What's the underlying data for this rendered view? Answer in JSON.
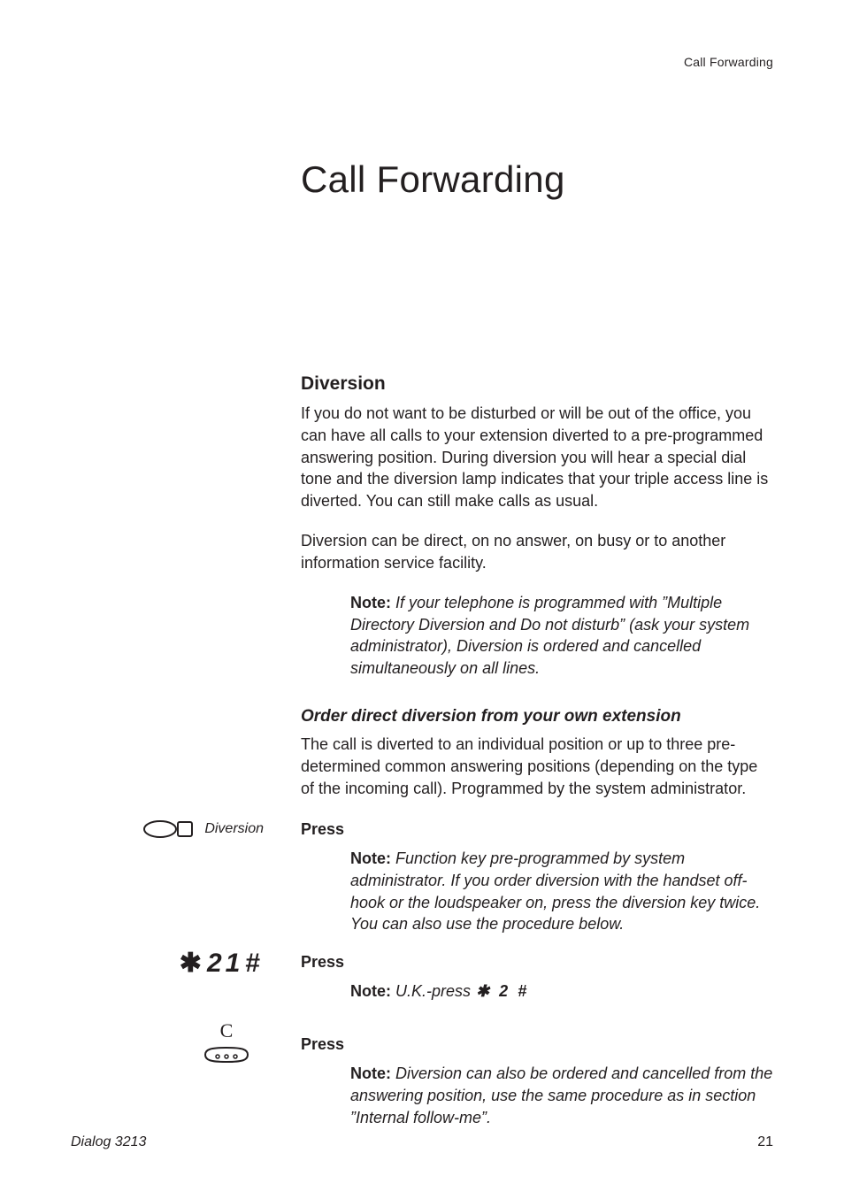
{
  "header": {
    "running": "Call Forwarding"
  },
  "chapter": {
    "title": "Call Forwarding"
  },
  "diversion": {
    "heading": "Diversion",
    "p1": "If you do not want to be disturbed or will be out of the office, you can have all calls to your extension diverted to a pre-programmed answering position. During diversion you will hear a special dial tone and the diversion lamp indicates that your triple access line is diverted. You can still make calls as usual.",
    "p2": "Diversion can be direct, on no answer, on busy or to another information service facility.",
    "note_label": "Note:",
    "note_body": "If your telephone is programmed with ”Multiple Directory Diversion and Do not disturb” (ask your system administrator), Diversion is ordered and cancelled simultaneously on all lines."
  },
  "orderDirect": {
    "heading": "Order direct diversion from your own extension",
    "p": "The call is diverted to an individual position or up to three pre-determined common answering positions (depending on the type of the incoming call). Programmed by the system administrator."
  },
  "step1": {
    "key_label": "Diversion",
    "press": "Press",
    "note_label": "Note:",
    "note_body": "Function key pre-programmed by system administrator. If you order diversion with the handset off-hook or the loudspeaker on, press the diversion key twice. You can also use the procedure below."
  },
  "step2": {
    "code_star": "✱",
    "code_digits": "21",
    "code_hash": "#",
    "press": "Press",
    "note_label": "Note:",
    "uk_prefix": "U.K.-press",
    "uk_star": "✱",
    "uk_digits": "2",
    "uk_hash": "#"
  },
  "step3": {
    "cancel_c": "C",
    "press": "Press",
    "note_label": "Note:",
    "note_body": "Diversion can also be ordered and cancelled from the answering position, use the same procedure as in section ”Internal follow-me”."
  },
  "footer": {
    "left": "Dialog 3213",
    "page": "21"
  }
}
